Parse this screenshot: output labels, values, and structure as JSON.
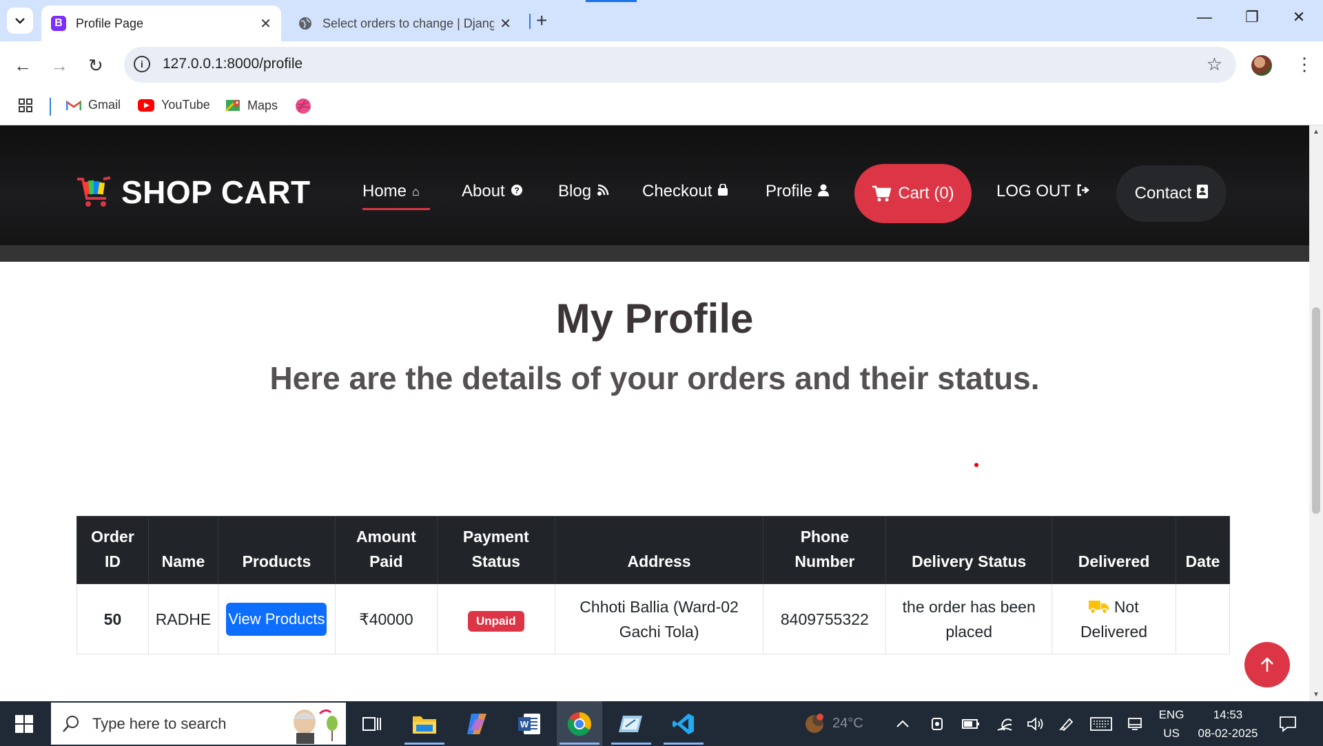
{
  "browser": {
    "tabs": [
      {
        "title": "Profile Page",
        "favicon": "bootstrap-icon",
        "active": true
      },
      {
        "title": "Select orders to change | Djang",
        "favicon": "globe-icon",
        "active": false
      }
    ],
    "url": "127.0.0.1:8000/profile",
    "bookmarks": [
      {
        "label": "Gmail",
        "icon": "gmail-icon"
      },
      {
        "label": "YouTube",
        "icon": "youtube-icon"
      },
      {
        "label": "Maps",
        "icon": "maps-icon"
      },
      {
        "label": "",
        "icon": "dribbble-icon"
      }
    ]
  },
  "site": {
    "brand": "SHOP CART",
    "nav": {
      "home": "Home",
      "about": "About",
      "blog": "Blog",
      "checkout": "Checkout",
      "profile": "Profile",
      "cart": "Cart (0)",
      "logout": "LOG OUT",
      "contact": "Contact"
    },
    "accent": "#dc3545"
  },
  "main": {
    "title": "My Profile",
    "subtitle": "Here are the details of your orders and their status."
  },
  "orders_table": {
    "headers": {
      "order_id": "Order ID",
      "name": "Name",
      "products": "Products",
      "amount": "Amount Paid",
      "payment": "Payment Status",
      "address": "Address",
      "phone": "Phone Number",
      "delivery": "Delivery Status",
      "delivered": "Delivered",
      "date": "Date"
    },
    "rows": [
      {
        "order_id": "50",
        "name": "RADHE",
        "products_button": "View Products",
        "amount": "₹40000",
        "payment_status": "Unpaid",
        "address": "Chhoti Ballia (Ward-02 Gachi Tola)",
        "phone": "8409755322",
        "delivery_status": "the order has been placed",
        "delivered": "Not Delivered",
        "date": ""
      }
    ]
  },
  "taskbar": {
    "search_placeholder": "Type here to search",
    "weather": "24°C",
    "lang_top": "ENG",
    "lang_bottom": "US",
    "time": "14:53",
    "date": "08-02-2025"
  }
}
